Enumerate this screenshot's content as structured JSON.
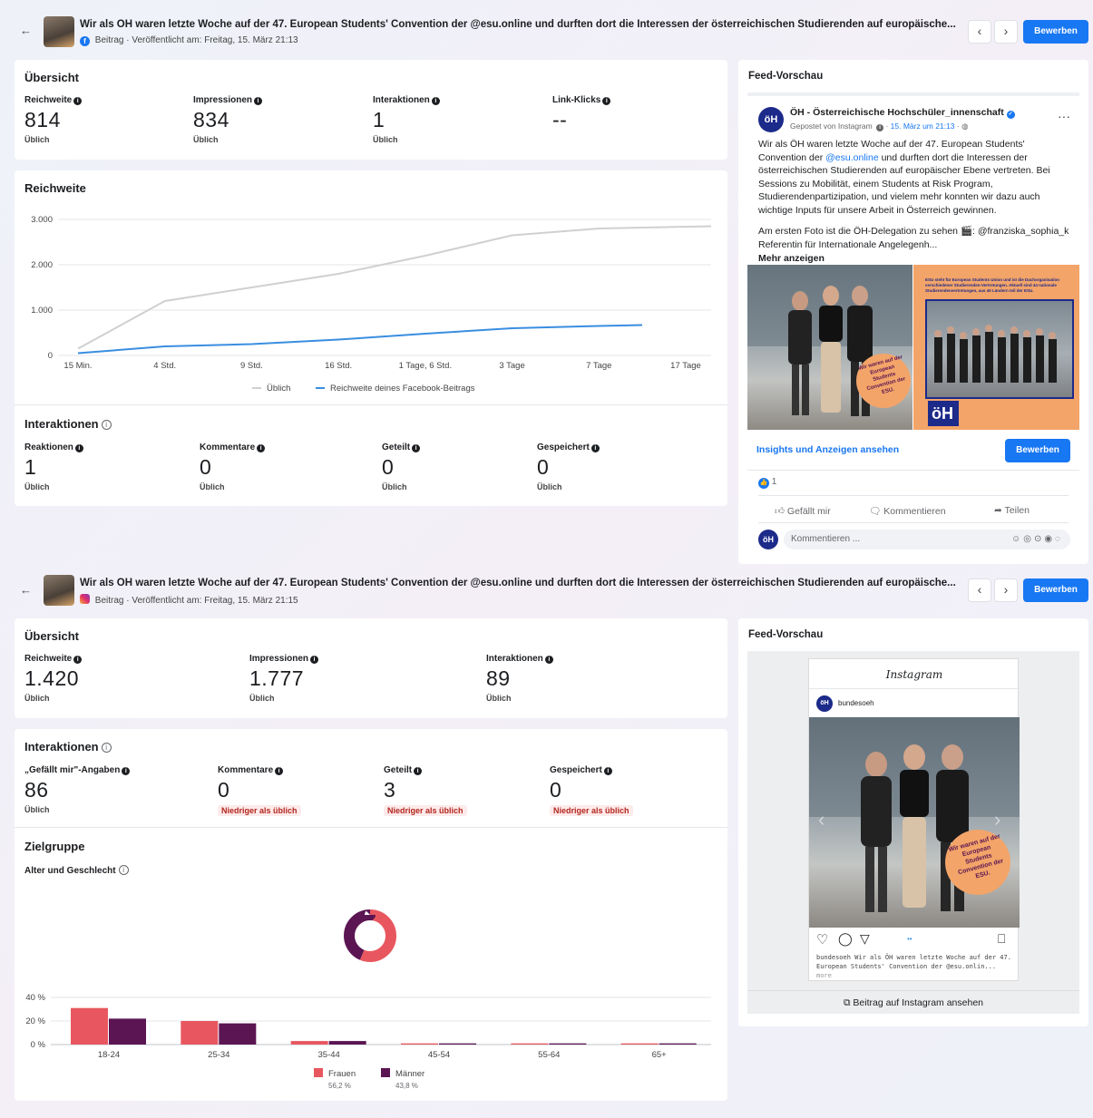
{
  "colors": {
    "accent": "#1877f2",
    "frauen": "#e8575f",
    "maenner": "#5b1552",
    "typical_line": "#d0d0d0",
    "reach_line": "#3a8ee0",
    "oh_orange": "#f3a469",
    "oh_blue": "#1c2a8a"
  },
  "facebook_post": {
    "title": "Wir als ÖH waren letzte Woche auf der 47. European Students' Convention der @esu.online und durften dort die Interessen der österreichischen Studierenden auf europäische...",
    "subtitle": "Beitrag · Veröffentlicht am: Freitag, 15. März 21:13",
    "platform_icon": "facebook-icon",
    "boost_label": "Bewerben",
    "overview": {
      "title": "Übersicht",
      "metrics": [
        {
          "label": "Reichweite",
          "value": "814",
          "status": "Üblich"
        },
        {
          "label": "Impressionen",
          "value": "834",
          "status": "Üblich"
        },
        {
          "label": "Interaktionen",
          "value": "1",
          "status": "Üblich"
        },
        {
          "label": "Link-Klicks",
          "value": "--",
          "status": ""
        }
      ]
    },
    "reach_chart_title": "Reichweite",
    "interactions": {
      "title": "Interaktionen",
      "metrics": [
        {
          "label": "Reaktionen",
          "value": "1",
          "status": "Üblich"
        },
        {
          "label": "Kommentare",
          "value": "0",
          "status": "Üblich"
        },
        {
          "label": "Geteilt",
          "value": "0",
          "status": "Üblich"
        },
        {
          "label": "Gespeichert",
          "value": "0",
          "status": "Üblich"
        }
      ]
    },
    "preview": {
      "title": "Feed-Vorschau",
      "page_name": "ÖH - Österreichische Hochschüler_innenschaft",
      "meta_prefix": "Gepostet von Instagram",
      "meta_date": "15. März um 21:13",
      "text_p1_a": "Wir als ÖH waren letzte Woche auf der 47. European Students' Convention der ",
      "text_p1_link": "@esu.online",
      "text_p1_b": " und durften dort die Interessen der österreichischen Studierenden auf europäischer Ebene vertreten. Bei Sessions zu Mobilität, einem Students at Risk Program, Studierendenpartizipation, und vielem mehr konnten wir dazu auch wichtige Inputs für unsere Arbeit in Österreich gewinnen.",
      "text_p2": "Am ersten Foto ist die ÖH-Delegation zu sehen 🎬: @franziska_sophia_k Referentin für Internationale Angelegenh...",
      "more": "Mehr anzeigen",
      "sticker": "Wir waren auf der European Students Convention der ESU.",
      "panel_text": "ESU steht für European Students Union und ist die Dachorganisation verschiedener Studierenden-Vertretungen. Aktuell sind 44 nationale Studierendenvertretungen, aus 40 Ländern teil der ESU.",
      "logo": "öH",
      "insights_link": "Insights und Anzeigen ansehen",
      "boost_label": "Bewerben",
      "reaction_count": "1",
      "like": "Gefällt mir",
      "comment": "Kommentieren",
      "share": "Teilen",
      "comment_placeholder": "Kommentieren ..."
    }
  },
  "instagram_post": {
    "title": "Wir als ÖH waren letzte Woche auf der 47. European Students' Convention der @esu.online und durften dort die Interessen der österreichischen Studierenden auf europäische...",
    "subtitle": "Beitrag · Veröffentlicht am: Freitag, 15. März 21:15",
    "platform_icon": "instagram-icon",
    "boost_label": "Bewerben",
    "overview": {
      "title": "Übersicht",
      "metrics": [
        {
          "label": "Reichweite",
          "value": "1.420",
          "status": "Üblich"
        },
        {
          "label": "Impressionen",
          "value": "1.777",
          "status": "Üblich"
        },
        {
          "label": "Interaktionen",
          "value": "89",
          "status": "Üblich"
        }
      ]
    },
    "interactions": {
      "title": "Interaktionen",
      "metrics": [
        {
          "label": "„Gefällt mir\"-Angaben",
          "value": "86",
          "status": "Üblich",
          "low": false
        },
        {
          "label": "Kommentare",
          "value": "0",
          "status": "Niedriger als üblich",
          "low": true
        },
        {
          "label": "Geteilt",
          "value": "3",
          "status": "Niedriger als üblich",
          "low": true
        },
        {
          "label": "Gespeichert",
          "value": "0",
          "status": "Niedriger als üblich",
          "low": true
        }
      ]
    },
    "audience": {
      "title": "Zielgruppe",
      "subtitle": "Alter und Geschlecht"
    },
    "preview": {
      "title": "Feed-Vorschau",
      "brand": "Instagram",
      "username": "bundesoeh",
      "caption": "bundesoeh Wir als ÖH waren letzte Woche auf der 47. European Students' Convention der @esu.onlin...",
      "caption_more": "more",
      "sticker": "Wir waren auf der European Students Convention der ESU.",
      "view_link": "Beitrag auf Instagram ansehen"
    }
  },
  "chart_data": [
    {
      "type": "line",
      "title": "Reichweite",
      "x": [
        "15 Min.",
        "4 Std.",
        "9 Std.",
        "16 Std.",
        "1 Tage, 6 Std.",
        "3 Tage",
        "7 Tage",
        "17 Tage"
      ],
      "ylim": [
        0,
        3000
      ],
      "yticks": [
        "0",
        "1.000",
        "2.000",
        "3.000"
      ],
      "series": [
        {
          "name": "Üblich",
          "values": [
            150,
            1200,
            1500,
            1800,
            2200,
            2650,
            2800,
            2850
          ]
        },
        {
          "name": "Reichweite deines Facebook-Beitrags",
          "values": [
            50,
            200,
            250,
            350,
            480,
            600,
            650,
            670
          ]
        }
      ],
      "legend": "bottom",
      "grid": true
    },
    {
      "type": "pie",
      "labels": [
        "Frauen",
        "Männer"
      ],
      "values": [
        56.2,
        43.8
      ],
      "value_labels": [
        "56,2 %",
        "43,8 %"
      ]
    },
    {
      "type": "bar",
      "categories": [
        "18-24",
        "25-34",
        "35-44",
        "45-54",
        "55-64",
        "65+"
      ],
      "ylim": [
        0,
        40
      ],
      "yticks": [
        "0 %",
        "20 %",
        "40 %"
      ],
      "series": [
        {
          "name": "Frauen",
          "values": [
            31,
            20,
            3,
            1,
            1,
            1
          ]
        },
        {
          "name": "Männer",
          "values": [
            22,
            18,
            3,
            1,
            1,
            1
          ]
        }
      ],
      "legend": "bottom",
      "grid": true
    }
  ]
}
